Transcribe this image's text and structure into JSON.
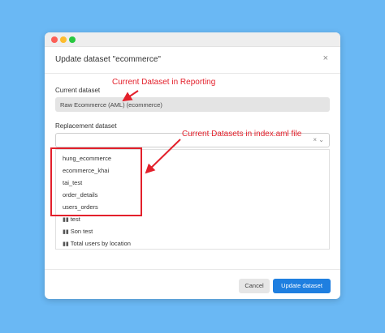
{
  "dialog": {
    "title": "Update dataset \"ecommerce\"",
    "close_glyph": "×"
  },
  "current": {
    "label": "Current dataset",
    "value": "Raw Ecommerce (AML) (ecommerce)"
  },
  "replacement": {
    "label": "Replacement dataset",
    "value": "",
    "icons": "× ⌄"
  },
  "dropdown": {
    "highlighted_options": [
      "hung_ecommerce",
      "ecommerce_khai",
      "tai_test",
      "order_details",
      "users_orders"
    ],
    "report_options": [
      {
        "icon": "bar-chart-icon",
        "label": "test"
      },
      {
        "icon": "bar-chart-icon",
        "label": "Son test"
      },
      {
        "icon": "bar-chart-icon",
        "label": "Total users by location"
      }
    ]
  },
  "annotations": {
    "current": "Current Dataset in Reporting",
    "replacement": "Current Datasets in index.aml file"
  },
  "footer": {
    "cancel_label": "Cancel",
    "update_label": "Update dataset"
  },
  "colors": {
    "background": "#6ab8f4",
    "annotation": "#e3202b",
    "primary_button": "#1f7fe0"
  }
}
